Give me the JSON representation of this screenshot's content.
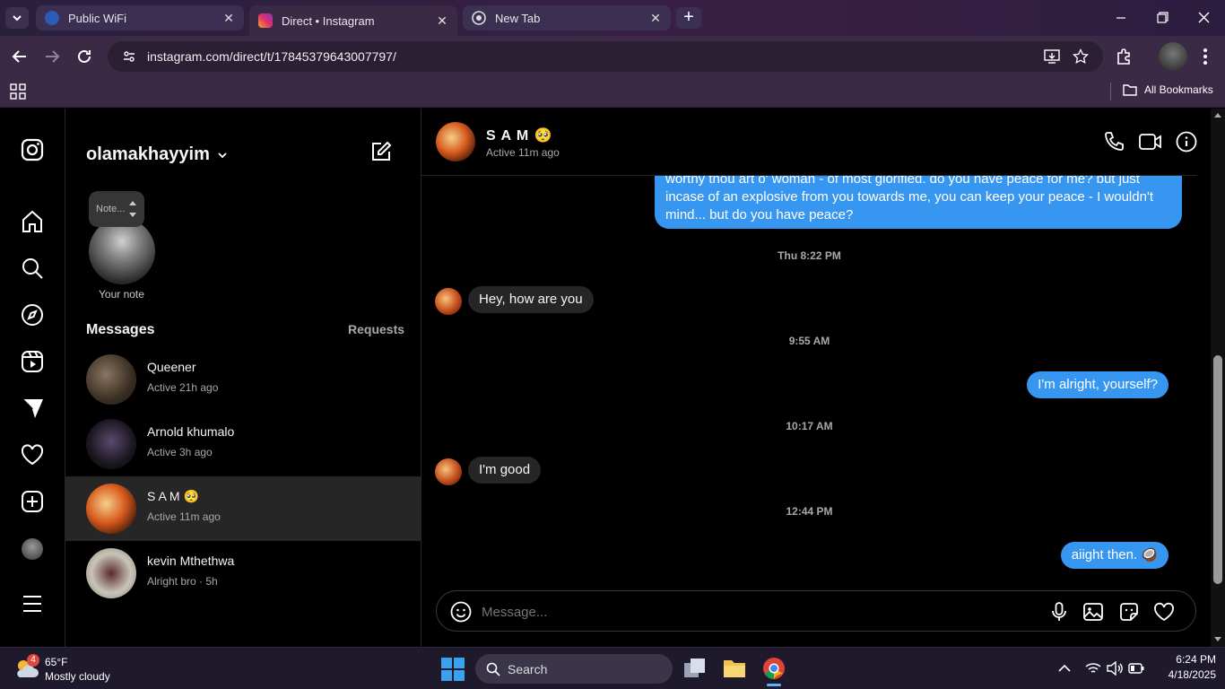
{
  "browser": {
    "tabs": [
      {
        "title": "Public WiFi",
        "active": false
      },
      {
        "title": "Direct • Instagram",
        "active": true
      },
      {
        "title": "New Tab",
        "active": false
      }
    ],
    "url": "instagram.com/direct/t/17845379643007797/",
    "bookmarks_label": "All Bookmarks"
  },
  "inbox": {
    "username": "olamakhayyim",
    "note_placeholder": "Note...",
    "your_note_label": "Your note",
    "messages_heading": "Messages",
    "requests_label": "Requests",
    "conversations": [
      {
        "name": "Queener",
        "status": "Active 21h ago",
        "selected": false
      },
      {
        "name": "Arnold khumalo",
        "status": "Active 3h ago",
        "selected": false
      },
      {
        "name": "S A M 🥺",
        "status": "Active 11m ago",
        "selected": true
      },
      {
        "name": "kevin Mthethwa",
        "status": "Alright bro · 5h",
        "selected": false
      }
    ]
  },
  "chat": {
    "contact_name": "S A M 🥺",
    "contact_status": "Active 11m ago",
    "messages": [
      {
        "type": "out",
        "text": "worthy thou art o' woman - of most glorified. do you have peace for me? but just incase of an explosive from you towards me, you can keep your peace - I wouldn't mind... but do you have peace?"
      },
      {
        "type": "time",
        "text": "Thu 8:22 PM"
      },
      {
        "type": "in",
        "text": "Hey, how are you"
      },
      {
        "type": "time",
        "text": "9:55 AM"
      },
      {
        "type": "out",
        "text": "I'm alright, yourself?"
      },
      {
        "type": "time",
        "text": "10:17 AM"
      },
      {
        "type": "in",
        "text": "I'm good"
      },
      {
        "type": "time",
        "text": "12:44 PM"
      },
      {
        "type": "out",
        "text": "aiight then. 🥥"
      }
    ],
    "composer_placeholder": "Message..."
  },
  "taskbar": {
    "weather_temp": "65°F",
    "weather_desc": "Mostly cloudy",
    "weather_badge": "4",
    "search_label": "Search",
    "time": "6:24 PM",
    "date": "4/18/2025"
  },
  "colors": {
    "accent": "#3797f0",
    "incoming_bubble": "#262626",
    "tabbar": "#2a1f3d",
    "toolbar": "#3a2a46"
  }
}
